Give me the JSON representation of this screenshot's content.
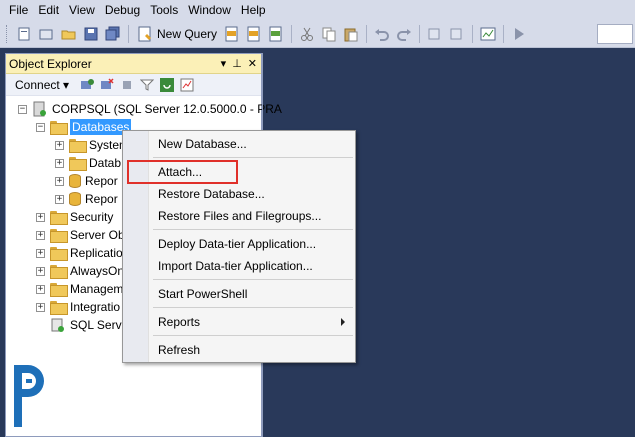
{
  "menu": [
    "File",
    "Edit",
    "View",
    "Debug",
    "Tools",
    "Window",
    "Help"
  ],
  "toolbar": {
    "new_query_label": "New Query"
  },
  "object_explorer": {
    "title": "Object Explorer",
    "pin_glyph": "− ↗ ×",
    "connect_label": "Connect ▾",
    "server": "CORPSQL (SQL Server 12.0.5000.0 - PRA",
    "databases": "Databases",
    "db_children": [
      "System",
      "Datab",
      "Repor",
      "Repor"
    ],
    "nodes": [
      "Security",
      "Server Ob",
      "Replicatio",
      "AlwaysOn",
      "Managem",
      "Integratio",
      "SQL Serve"
    ]
  },
  "context_menu": {
    "items": [
      "New Database...",
      "Attach...",
      "Restore Database...",
      "Restore Files and Filegroups...",
      "Deploy Data-tier Application...",
      "Import Data-tier Application...",
      "Start PowerShell",
      "Reports",
      "Refresh"
    ]
  },
  "colors": {
    "background": "#29395a",
    "highlight_box": "#e0302a",
    "selection": "#3399ff",
    "oe_title": "#fbf0b7"
  }
}
